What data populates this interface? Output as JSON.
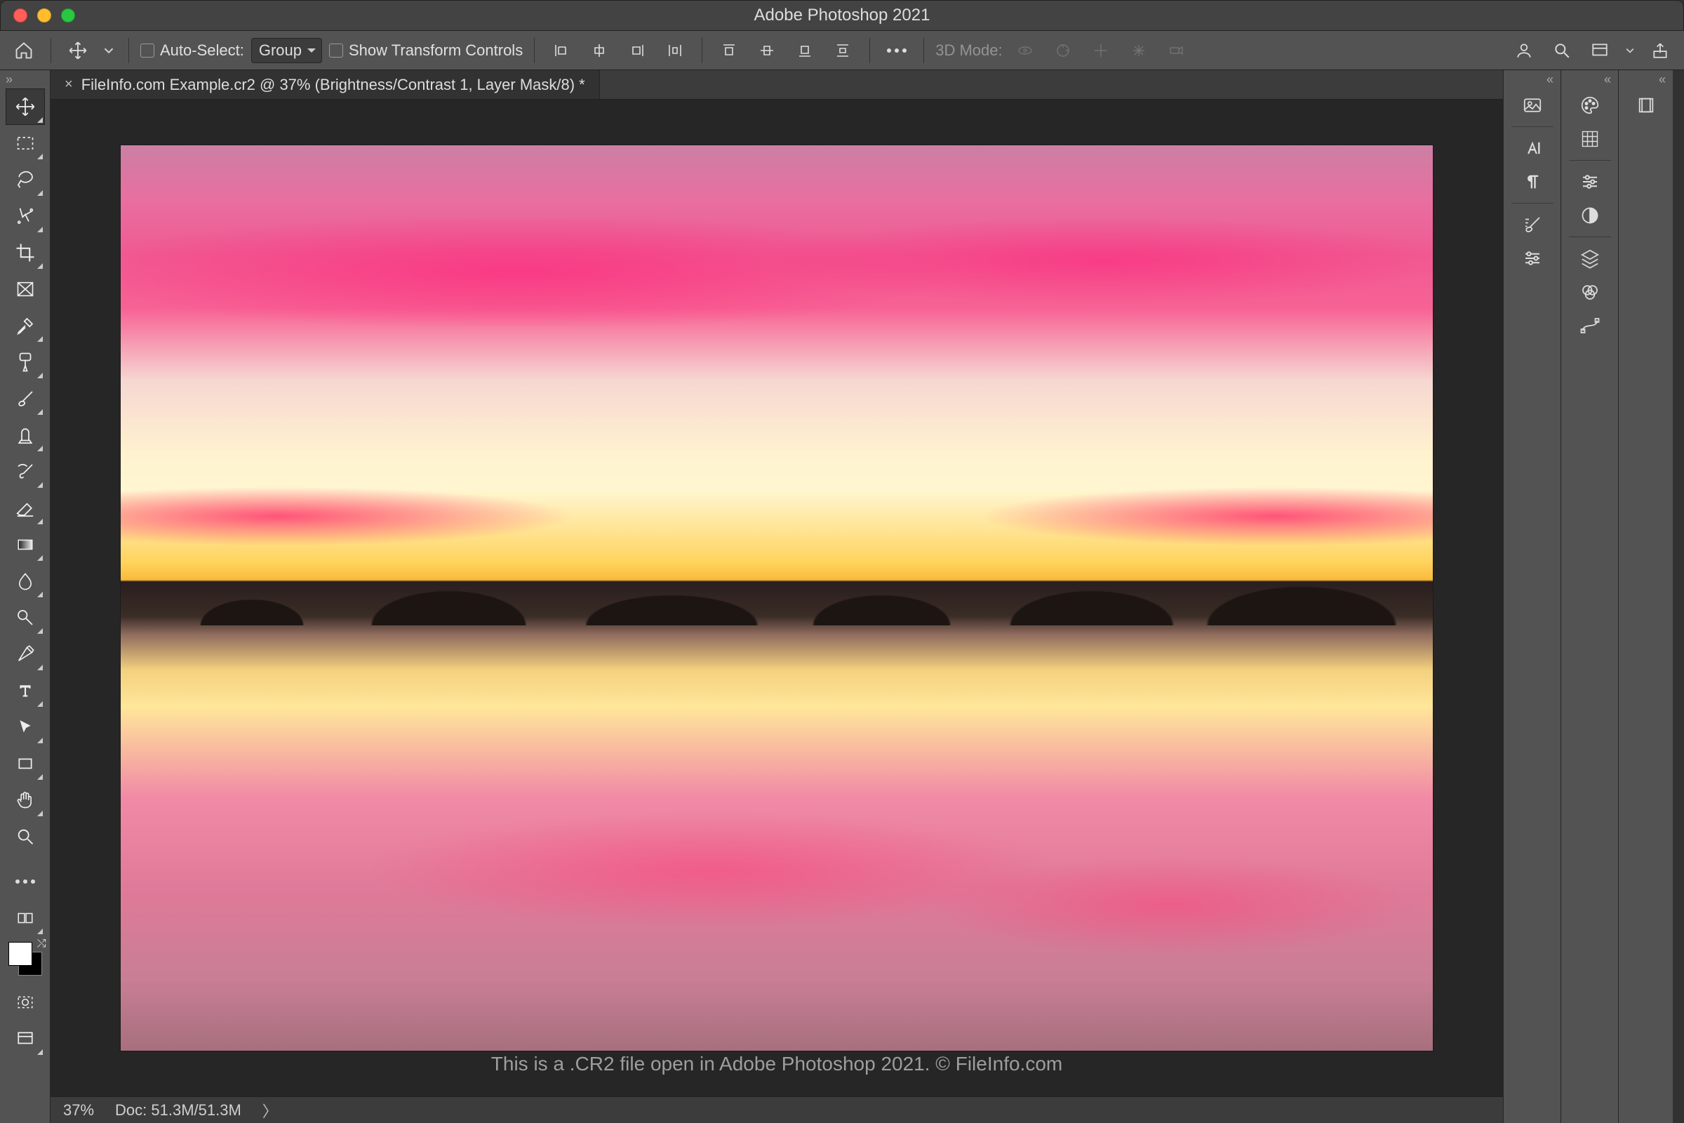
{
  "app": {
    "title": "Adobe Photoshop 2021"
  },
  "options": {
    "auto_select_label": "Auto-Select:",
    "group_select": "Group",
    "show_transform_label": "Show Transform Controls",
    "threed_mode_label": "3D Mode:"
  },
  "tab": {
    "title": "FileInfo.com Example.cr2 @ 37% (Brightness/Contrast 1, Layer Mask/8) *"
  },
  "caption": "This is a .CR2 file open in Adobe Photoshop 2021. © FileInfo.com",
  "status": {
    "zoom": "37%",
    "doc": "Doc: 51.3M/51.3M"
  },
  "tools": [
    "move",
    "rect-marquee",
    "lasso",
    "magic-wand",
    "crop",
    "frame",
    "eyedropper",
    "healing",
    "brush",
    "clone",
    "history-brush",
    "eraser",
    "gradient",
    "blur",
    "dodge",
    "pen",
    "type",
    "path-select",
    "rectangle",
    "hand",
    "zoom"
  ],
  "right_cols": {
    "col1": [
      "history",
      "character",
      "paragraph",
      "brushes",
      "brush-settings"
    ],
    "col2": [
      "color",
      "swatches",
      "adjustments",
      "balance",
      "layers",
      "channels",
      "paths"
    ]
  },
  "colors": {
    "fg": "#ffffff",
    "bg": "#000000",
    "ui_bg": "#535353",
    "canvas_bg": "#262626"
  }
}
